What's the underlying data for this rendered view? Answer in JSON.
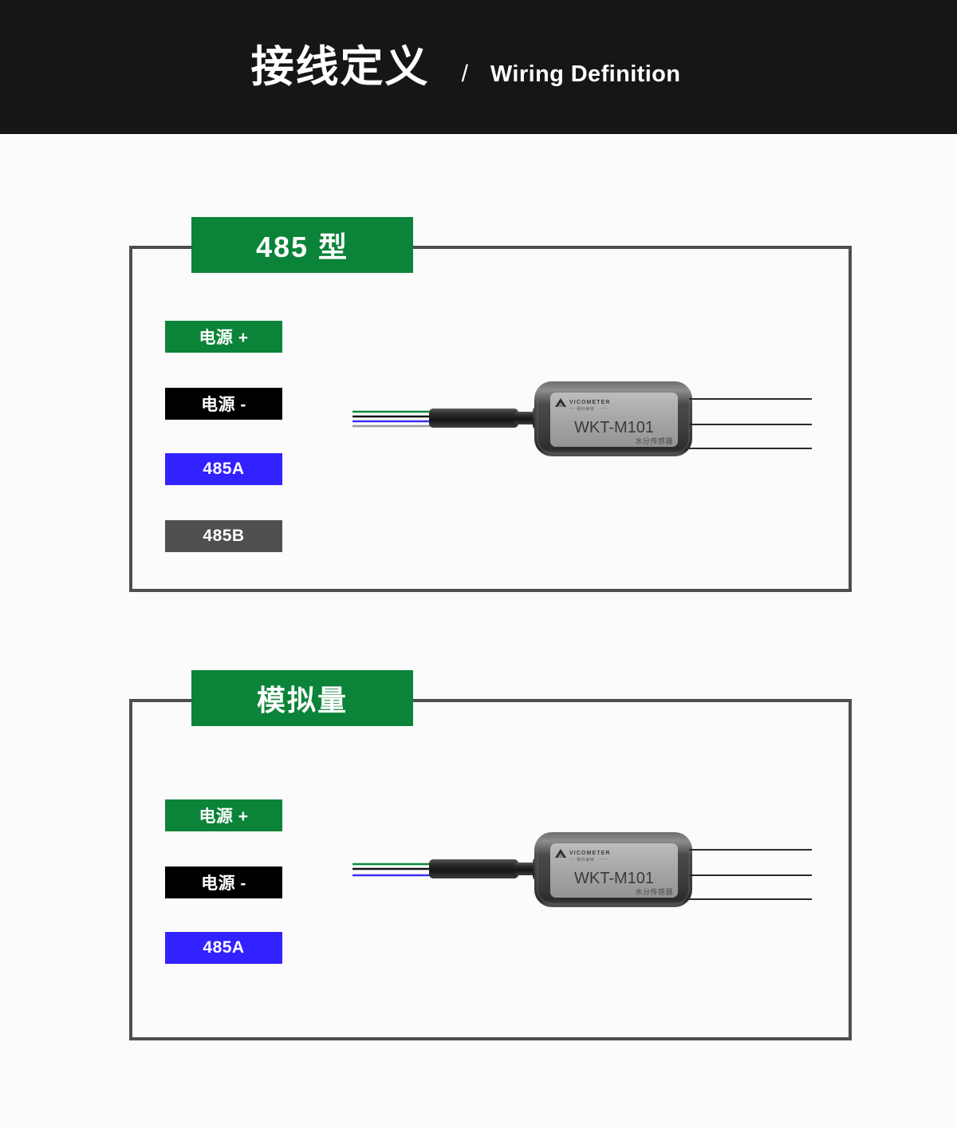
{
  "header": {
    "title_cn": "接线定义",
    "separator": "/",
    "title_en": "Wiring Definition"
  },
  "colors": {
    "header_bg": "#161616",
    "page_bg": "#fbfbfb",
    "panel_border": "#4e4e4e",
    "brand_green": "#0b8338",
    "tag_black": "#000000",
    "tag_blue": "#3222ff",
    "tag_gray": "#4f4f4f",
    "text_white": "#ffffff",
    "wire_green": "#0c8b3c",
    "wire_black": "#111111",
    "wire_blue": "#3a2ff5",
    "wire_gray": "#9a9a9a"
  },
  "sections": [
    {
      "id": "rs485",
      "badge": "485 型",
      "tags": [
        {
          "label": "电源 +",
          "bg": "#0b8338",
          "color": "#ffffff",
          "name": "tag-power-positive"
        },
        {
          "label": "电源 -",
          "bg": "#000000",
          "color": "#ffffff",
          "name": "tag-power-negative"
        },
        {
          "label": "485A",
          "bg": "#3222ff",
          "color": "#ffffff",
          "name": "tag-485a"
        },
        {
          "label": "485B",
          "bg": "#4f4f4f",
          "color": "#ffffff",
          "name": "tag-485b"
        }
      ],
      "wire_colors": [
        "#0c8b3c",
        "#111111",
        "#3a2ff5",
        "#9a9a9a"
      ],
      "device": {
        "model": "WKT-M101",
        "subtitle": "水分传感器",
        "brand": "VICOMETER",
        "brand_cn": "维科美特",
        "probe_count": 3
      }
    },
    {
      "id": "analog",
      "badge": "模拟量",
      "tags": [
        {
          "label": "电源 +",
          "bg": "#0b8338",
          "color": "#ffffff",
          "name": "tag-power-positive"
        },
        {
          "label": "电源 -",
          "bg": "#000000",
          "color": "#ffffff",
          "name": "tag-power-negative"
        },
        {
          "label": "485A",
          "bg": "#3222ff",
          "color": "#ffffff",
          "name": "tag-485a"
        }
      ],
      "wire_colors": [
        "#0c8b3c",
        "#111111",
        "#3a2ff5"
      ],
      "device": {
        "model": "WKT-M101",
        "subtitle": "水分传感器",
        "brand": "VICOMETER",
        "brand_cn": "维科美特",
        "probe_count": 3
      }
    }
  ]
}
